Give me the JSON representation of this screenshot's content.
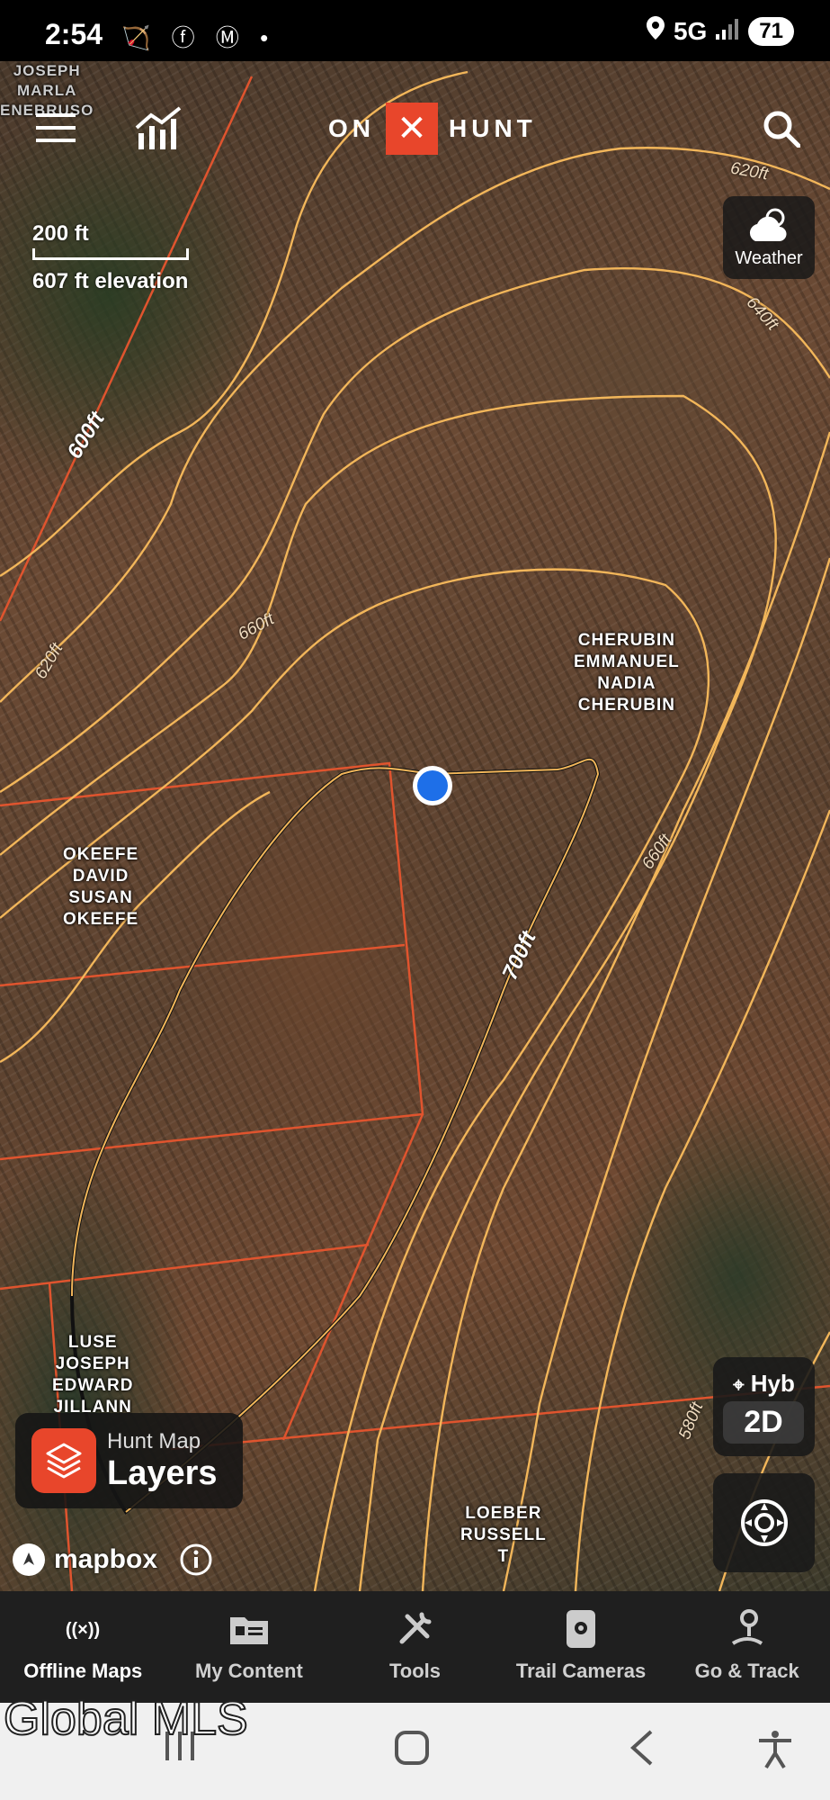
{
  "status_bar": {
    "time": "2:54",
    "network": "5G",
    "battery": "71",
    "icons_left": [
      "hunting-icon",
      "facebook-icon",
      "gmail-icon",
      "dot"
    ],
    "icons_right": [
      "location-icon",
      "signal-icon"
    ]
  },
  "header": {
    "logo_left": "ON",
    "logo_mark": "✕",
    "logo_right": "HUNT"
  },
  "scale": {
    "distance": "200 ft",
    "elevation": "607 ft elevation"
  },
  "weather": {
    "label": "Weather"
  },
  "owners": [
    {
      "text": "JOSEPH\nMARLA\nENEBRUSO"
    },
    {
      "text": "CHERUBIN\nEMMANUEL\nNADIA\nCHERUBIN"
    },
    {
      "text": "OKEEFE\nDAVID\nSUSAN\nOKEEFE"
    },
    {
      "text": "LUSE\nJOSEPH\nEDWARD\nJILLANN"
    },
    {
      "text": "LOEBER\nRUSSELL\nT"
    }
  ],
  "contour_labels": [
    "620ft",
    "640ft",
    "600ft",
    "660ft",
    "620ft",
    "660ft",
    "700ft",
    "580ft"
  ],
  "map_controls": {
    "mode": "Hyb",
    "dimension": "2D"
  },
  "layers_button": {
    "sub": "Hunt Map",
    "main": "Layers"
  },
  "attribution": {
    "text": "mapbox"
  },
  "bottom_nav": [
    {
      "label": "Offline Maps",
      "icon": "offline-broadcast-icon"
    },
    {
      "label": "My Content",
      "icon": "folder-icon"
    },
    {
      "label": "Tools",
      "icon": "tools-icon"
    },
    {
      "label": "Trail Cameras",
      "icon": "camera-icon"
    },
    {
      "label": "Go & Track",
      "icon": "track-pin-icon"
    }
  ],
  "watermark": "Global MLS",
  "colors": {
    "accent": "#e8462b",
    "location_dot": "#1e6fe8",
    "contour": "#f2b65a",
    "property_line": "#e0542e"
  }
}
